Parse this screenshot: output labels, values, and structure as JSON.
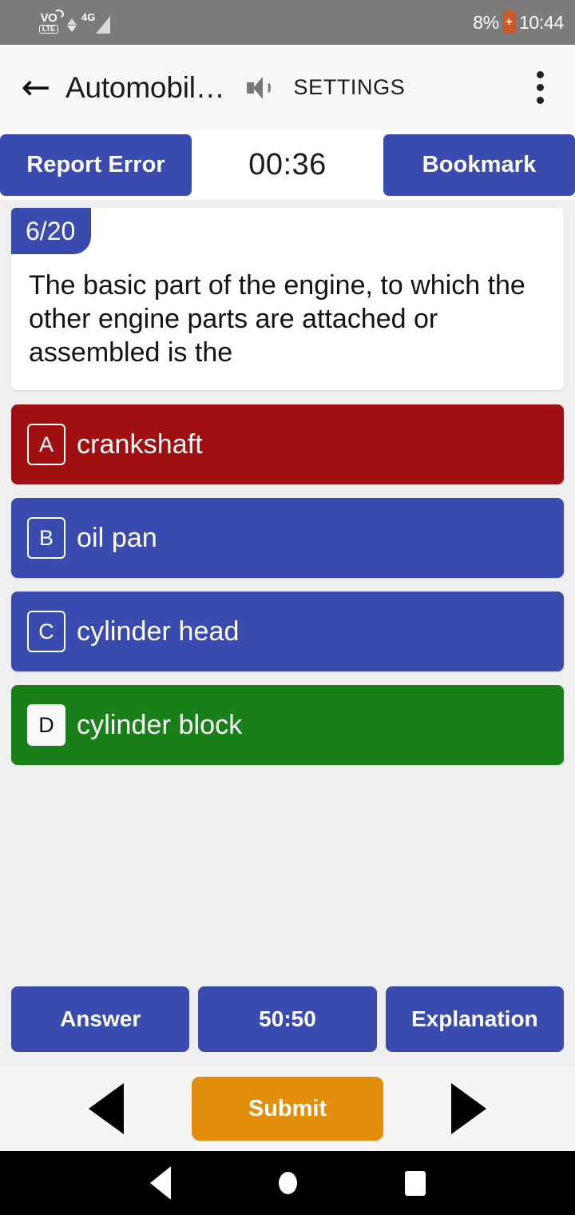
{
  "status_bar": {
    "volte_top": "VO",
    "volte_bottom": "LTE",
    "network": "4G",
    "battery_percent": "8%",
    "time": "10:44",
    "battery_color": "#d2581f",
    "background": "#7b7b7b"
  },
  "app_bar": {
    "back_icon": "back-arrow-icon",
    "title": "Automobil…",
    "volume_icon": "volume-speaker-icon",
    "settings_label": "SETTINGS",
    "overflow_icon": "more-vertical-icon",
    "background": "#f7f7f7"
  },
  "toolbar": {
    "report_error_label": "Report Error",
    "timer": "00:36",
    "bookmark_label": "Bookmark",
    "button_color": "#3a4bb0"
  },
  "question_card": {
    "counter": "6/20",
    "current": 6,
    "total": 20,
    "text": "The basic part of the engine, to which the other engine parts are attached or assembled is the"
  },
  "options": [
    {
      "letter": "A",
      "text": "crankshaft",
      "state": "wrong-selected",
      "color": "#a11010",
      "badge_style": "outline"
    },
    {
      "letter": "B",
      "text": "oil pan",
      "state": "default",
      "color": "#3a4bb0",
      "badge_style": "outline"
    },
    {
      "letter": "C",
      "text": "cylinder head",
      "state": "default",
      "color": "#3a4bb0",
      "badge_style": "outline"
    },
    {
      "letter": "D",
      "text": "cylinder block",
      "state": "correct",
      "color": "#198019",
      "badge_style": "solid"
    }
  ],
  "actions": {
    "answer_label": "Answer",
    "fifty_fifty_label": "50:50",
    "explanation_label": "Explanation"
  },
  "bottom_bar": {
    "prev_icon": "previous-triangle-icon",
    "submit_label": "Submit",
    "submit_color": "#e28e0c",
    "next_icon": "next-triangle-icon"
  },
  "android_nav": {
    "back_icon": "android-back-icon",
    "home_icon": "android-home-icon",
    "recents_icon": "android-recents-icon"
  }
}
